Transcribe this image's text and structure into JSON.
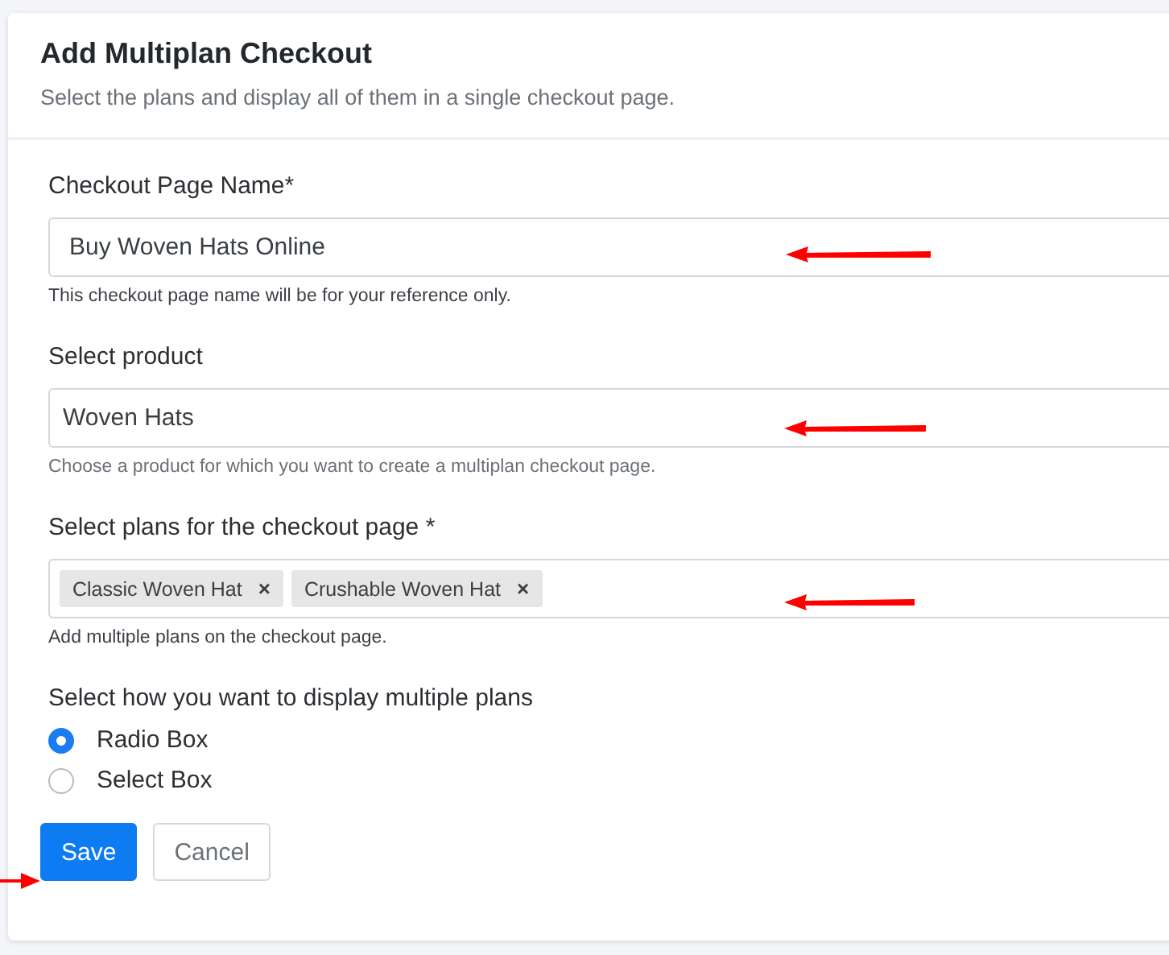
{
  "header": {
    "title": "Add Multiplan Checkout",
    "subtitle": "Select the plans and display all of them in a single checkout page."
  },
  "fields": [
    {
      "kind": "text",
      "label": "Checkout Page Name*",
      "value": "Buy Woven Hats Online",
      "help": "This checkout page name will be for your reference only."
    },
    {
      "kind": "text",
      "label": "Select product",
      "value": "Woven Hats",
      "help": "Choose a product for which you want to create a multiplan checkout page."
    },
    {
      "kind": "tags",
      "label": "Select plans for the checkout page *",
      "tags": [
        {
          "label": "Classic Woven Hat",
          "remove": "×"
        },
        {
          "label": "Crushable Woven Hat",
          "remove": "×"
        }
      ],
      "help": "Add multiple plans on the checkout page."
    }
  ],
  "display": {
    "label": "Select how you want to display multiple plans",
    "options": [
      {
        "label": "Radio Box",
        "selected": true
      },
      {
        "label": "Select Box",
        "selected": false
      }
    ]
  },
  "buttons": [
    {
      "label": "Save",
      "kind": "primary"
    },
    {
      "label": "Cancel",
      "kind": "secondary"
    }
  ]
}
